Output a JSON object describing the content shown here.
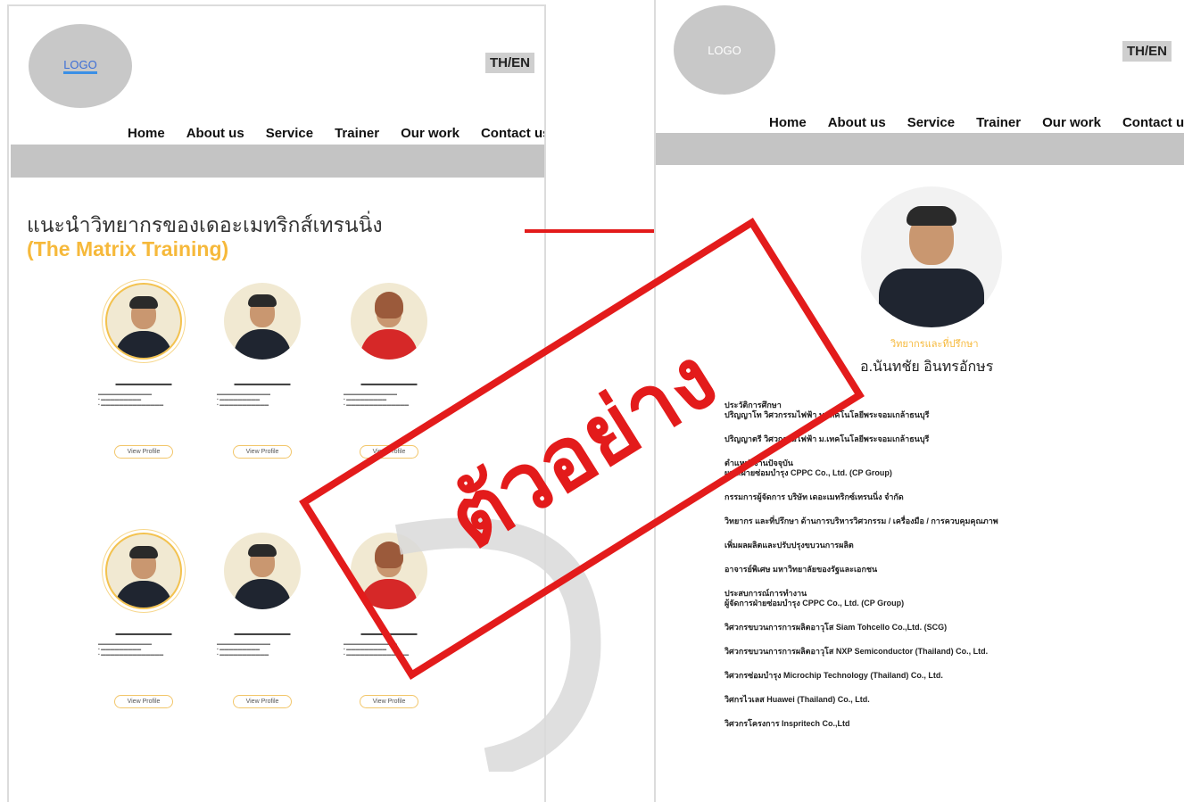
{
  "left_page": {
    "logo": "LOGO",
    "lang": "TH/EN",
    "nav": [
      "Home",
      "About us",
      "Service",
      "Trainer",
      "Our work",
      "Contact us"
    ],
    "title_th": "แนะนำวิทยากรของเดอะเมทริกส์เทรนนิ่ง",
    "title_en": "(The Matrix Training)",
    "view_profile": "View Profile"
  },
  "right_page": {
    "logo": "LOGO",
    "lang": "TH/EN",
    "nav": [
      "Home",
      "About us",
      "Service",
      "Trainer",
      "Our work",
      "Contact us"
    ],
    "role": "วิทยากรและที่ปรึกษา",
    "name": "อ.นันทชัย อินทรอักษร",
    "bio": [
      [
        "ประวัติการศึกษา",
        "ปริญญาโท วิศวกรรมไฟฟ้า ม.เทคโนโลยีพระจอมเกล้าธนบุรี"
      ],
      [
        "ปริญญาตรี วิศวกรรมไฟฟ้า ม.เทคโนโลยีพระจอมเกล้าธนบุรี"
      ],
      [
        "ตำแหน่งงานปัจจุบัน",
        "ผจก.ฝ่ายซ่อมบำรุง CPPC Co., Ltd. (CP Group)"
      ],
      [
        "กรรมการผู้จัดการ บริษัท เดอะเมทริกซ์เทรนนิ่ง จำกัด"
      ],
      [
        "วิทยากร และที่ปรึกษา ด้านการบริหารวิศวกรรม / เครื่องมือ / การควบคุมคุณภาพ"
      ],
      [
        "เพิ่มผลผลิตและปรับปรุงขบวนการผลิต"
      ],
      [
        "อาจารย์พิเศษ มหาวิทยาลัยของรัฐและเอกชน"
      ],
      [
        "ประสบการณ์การทำงาน",
        "ผู้จัดการฝ่ายซ่อมบำรุง CPPC Co., Ltd. (CP Group)"
      ],
      [
        "วิศวกรขบวนการการผลิตอาวุโส Siam Tohcello Co.,Ltd. (SCG)"
      ],
      [
        "วิศวกรขบวนการการผลิตอาวุโส NXP Semiconductor (Thailand) Co., Ltd."
      ],
      [
        "วิศวกรซ่อมบำรุง Microchip Technology (Thailand) Co., Ltd."
      ],
      [
        "วิศกรไวเลส Huawei (Thailand) Co., Ltd."
      ],
      [
        "วิศวกรโครงการ Inspritech Co.,Ltd"
      ]
    ]
  },
  "watermark": "ตัวอย่าง",
  "colors": {
    "accent": "#f6b93b",
    "watermark": "#e31b1b",
    "banner": "#c4c4c4"
  }
}
